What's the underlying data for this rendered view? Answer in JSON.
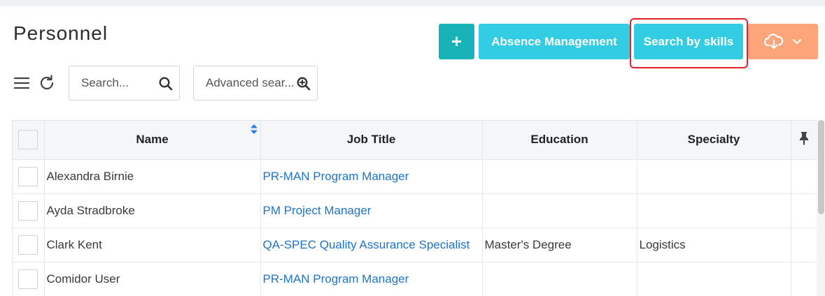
{
  "page": {
    "title": "Personnel"
  },
  "toolbar": {
    "add_label": "+",
    "absence_label": "Absence Management",
    "skills_label": "Search by skills",
    "search_placeholder": "Search...",
    "advanced_search_placeholder": "Advanced sear..."
  },
  "colors": {
    "add_button": "#17b3b9",
    "action_button": "#33cde3",
    "export_button": "#fca57a",
    "highlight": "#e3202a",
    "link": "#1e74c8"
  },
  "icons": {
    "menu": "hamburger-icon",
    "refresh": "refresh-icon",
    "search": "magnifier-icon",
    "advanced": "zoom-plus-icon",
    "export": "cloud-download-icon",
    "dropdown": "chevron-down-icon",
    "sort": "sort-icon",
    "pin": "pin-icon"
  },
  "table": {
    "columns": [
      "Name",
      "Job Title",
      "Education",
      "Specialty"
    ],
    "rows": [
      {
        "name": "Alexandra Birnie",
        "job_title": "PR-MAN Program Manager",
        "education": "",
        "specialty": ""
      },
      {
        "name": "Ayda Stradbroke",
        "job_title": "PM Project Manager",
        "education": "",
        "specialty": ""
      },
      {
        "name": "Clark Kent",
        "job_title": "QA-SPEC Quality Assurance Specialist",
        "education": "Master's Degree",
        "specialty": "Logistics"
      },
      {
        "name": "Comidor User",
        "job_title": "PR-MAN Program Manager",
        "education": "",
        "specialty": ""
      }
    ]
  }
}
